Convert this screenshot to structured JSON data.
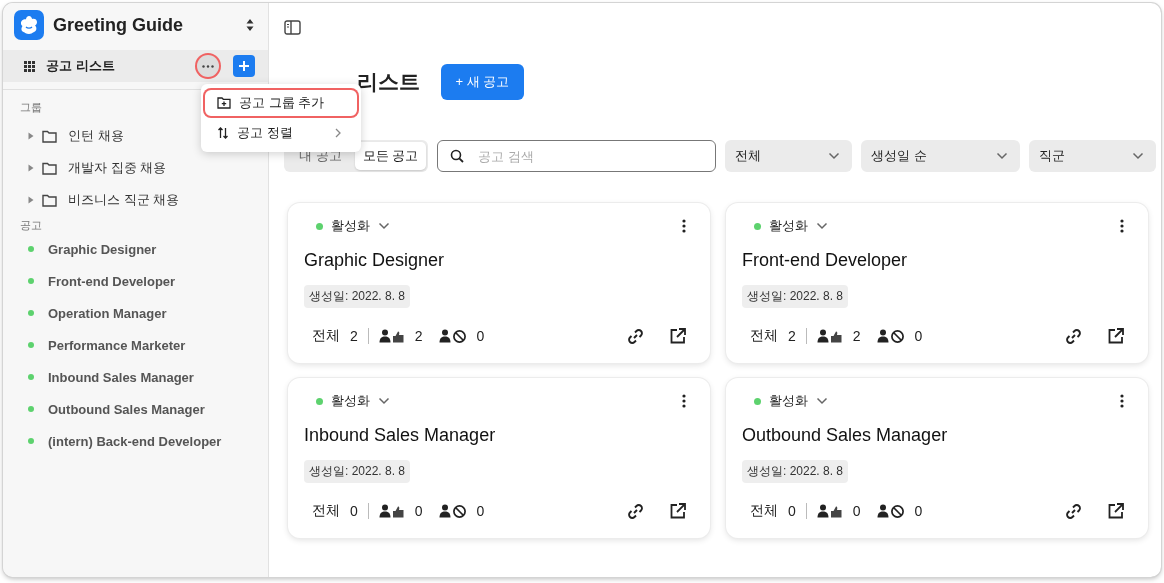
{
  "sidebar": {
    "workspace": "Greeting Guide",
    "nav_item": {
      "label": "공고 리스트",
      "selected": true
    },
    "groups_heading": "그룹",
    "groups": [
      {
        "label": "인턴 채용",
        "expanded": false
      },
      {
        "label": "개발자 집중 채용",
        "expanded": false
      },
      {
        "label": "비즈니스 직군 채용",
        "expanded": false
      }
    ],
    "jobs_heading": "공고",
    "jobs": [
      {
        "label": "Graphic Designer"
      },
      {
        "label": "Front-end Developer"
      },
      {
        "label": "Operation Manager"
      },
      {
        "label": "Performance Marketer"
      },
      {
        "label": "Inbound Sales Manager"
      },
      {
        "label": "Outbound Sales Manager"
      },
      {
        "label": "(intern) Back-end Developer"
      }
    ]
  },
  "menu": {
    "items": [
      {
        "kind": "add",
        "label": "공고 그룹 추가",
        "highlighted": true
      },
      {
        "kind": "submenu",
        "label": "공고 정렬",
        "highlighted": false
      }
    ]
  },
  "main": {
    "title": "리스트",
    "new_button": "+ 새 공고",
    "segments": [
      {
        "label": "내 공고",
        "selected": false
      },
      {
        "label": "모든 공고",
        "selected": true
      }
    ],
    "search": {
      "placeholder": "공고 검색"
    },
    "selects": [
      "전체",
      "생성일 순",
      "직군"
    ],
    "cards": [
      {
        "status": "활성화",
        "active": true,
        "title": "Graphic Designer",
        "date": "생성일: 2022. 8. 8",
        "total_label": "전체",
        "total": "2",
        "passed": "2",
        "rejected": "0"
      },
      {
        "status": "활성화",
        "active": true,
        "title": "Front-end Developer",
        "date": "생성일: 2022. 8. 8",
        "total_label": "전체",
        "total": "2",
        "passed": "2",
        "rejected": "0"
      },
      {
        "status": "활성화",
        "active": true,
        "title": "Inbound Sales Manager",
        "date": "생성일: 2022. 8. 8",
        "total_label": "전체",
        "total": "0",
        "passed": "0",
        "rejected": "0"
      },
      {
        "status": "활성화",
        "active": true,
        "title": "Outbound Sales Manager",
        "date": "생성일: 2022. 8. 8",
        "total_label": "전체",
        "total": "0",
        "passed": "0",
        "rejected": "0"
      }
    ]
  }
}
